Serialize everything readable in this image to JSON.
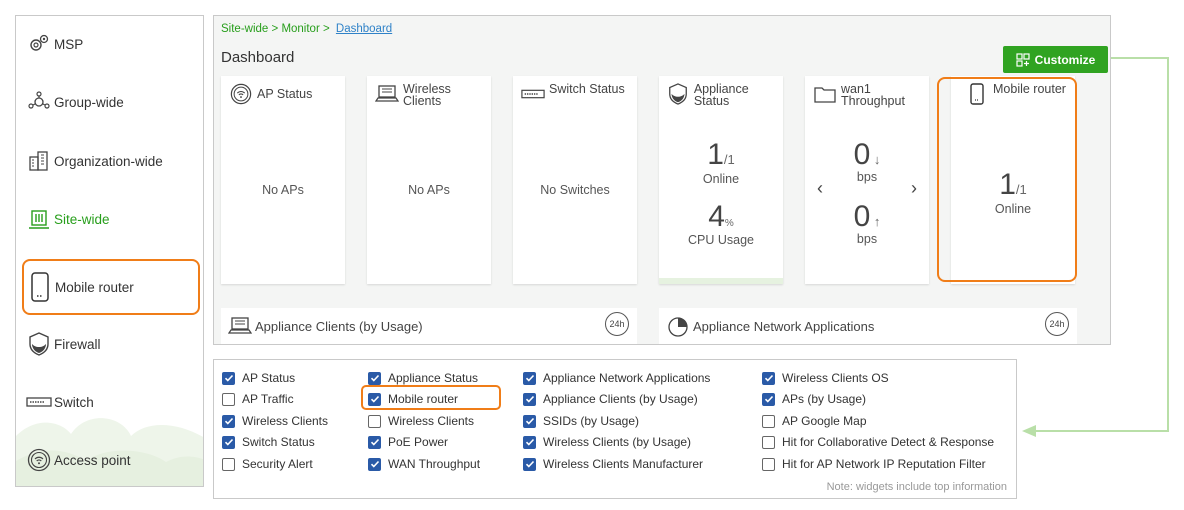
{
  "sidebar": {
    "items": [
      {
        "label": "MSP",
        "icon": "gears-icon"
      },
      {
        "label": "Group-wide",
        "icon": "network-icon"
      },
      {
        "label": "Organization-wide",
        "icon": "buildings-icon"
      },
      {
        "label": "Site-wide",
        "icon": "site-icon"
      },
      {
        "label": "Mobile router",
        "icon": "mobile-router-icon"
      },
      {
        "label": "Firewall",
        "icon": "shield-icon"
      },
      {
        "label": "Switch",
        "icon": "switch-icon"
      },
      {
        "label": "Access point",
        "icon": "wifi-icon"
      }
    ]
  },
  "dashboard": {
    "breadcrumb": {
      "part1": "Site-wide",
      "part2": "Monitor",
      "link": "Dashboard"
    },
    "title": "Dashboard",
    "customize_label": "Customize",
    "cards": {
      "ap_status": {
        "title": "AP Status",
        "value": "No APs"
      },
      "wireless_clients": {
        "title": "Wireless Clients",
        "value": "No APs"
      },
      "switch_status": {
        "title": "Switch Status",
        "value": "No Switches"
      },
      "appliance_status": {
        "title": "Appliance Status",
        "online_value": "1",
        "online_total": "/1",
        "online_label": "Online",
        "cpu_value": "4",
        "cpu_unit": "%",
        "cpu_label": "CPU Usage"
      },
      "wan1_throughput": {
        "title": "wan1 Throughput",
        "down_value": "0",
        "down_unit": "bps",
        "up_value": "0",
        "up_unit": "bps"
      },
      "mobile_router": {
        "title": "Mobile router",
        "value": "1",
        "total": "/1",
        "label": "Online"
      }
    },
    "bottom": {
      "appliance_clients": {
        "title": "Appliance Clients (by Usage)",
        "badge": "24h"
      },
      "appliance_apps": {
        "title": "Appliance Network Applications",
        "badge": "24h"
      }
    }
  },
  "checklist": {
    "columns": [
      [
        {
          "label": "AP Status",
          "checked": true
        },
        {
          "label": "AP Traffic",
          "checked": false
        },
        {
          "label": "Wireless Clients",
          "checked": true
        },
        {
          "label": "Switch Status",
          "checked": true
        },
        {
          "label": "Security Alert",
          "checked": false
        }
      ],
      [
        {
          "label": "Appliance Status",
          "checked": true
        },
        {
          "label": "Mobile router",
          "checked": true
        },
        {
          "label": "Wireless Clients",
          "checked": false
        },
        {
          "label": "PoE Power",
          "checked": true
        },
        {
          "label": "WAN Throughput",
          "checked": true
        }
      ],
      [
        {
          "label": "Appliance Network Applications",
          "checked": true
        },
        {
          "label": "Appliance Clients (by Usage)",
          "checked": true
        },
        {
          "label": "SSIDs (by Usage)",
          "checked": true
        },
        {
          "label": "Wireless Clients (by Usage)",
          "checked": true
        },
        {
          "label": "Wireless Clients Manufacturer",
          "checked": true
        }
      ],
      [
        {
          "label": "Wireless Clients OS",
          "checked": true
        },
        {
          "label": "APs (by Usage)",
          "checked": true
        },
        {
          "label": "AP Google Map",
          "checked": false
        },
        {
          "label": "Hit for Collaborative Detect & Response",
          "checked": false
        },
        {
          "label": "Hit for AP Network IP Reputation Filter",
          "checked": false
        }
      ]
    ],
    "note": "Note: widgets include top information"
  },
  "colors": {
    "accent_green": "#30a321",
    "highlight_orange": "#f07d18",
    "checkbox_blue": "#2a5aa7",
    "link_blue": "#2f82c8"
  }
}
